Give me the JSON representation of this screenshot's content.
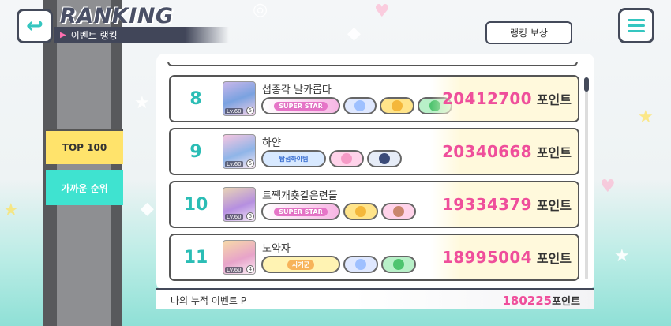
{
  "header": {
    "title": "RANKING",
    "subtitle": "이벤트 랭킹",
    "reward_button": "랭킹 보상"
  },
  "side_tabs": [
    {
      "label": "TOP 100"
    },
    {
      "label": "가까운 순위"
    }
  ],
  "rows": [
    {
      "rank": "8",
      "name": "섭종각 날카롭다",
      "points": "20412700",
      "unit": "포인트",
      "avatar_lv": "Lv.60",
      "star": "5",
      "badges": [
        "superstar",
        "blue",
        "small-gold",
        "small-green"
      ]
    },
    {
      "rank": "9",
      "name": "하얀",
      "points": "20340668",
      "unit": "포인트",
      "avatar_lv": "Lv.60",
      "star": "5",
      "badges": [
        "blue-text",
        "small-pink",
        "small-navy"
      ]
    },
    {
      "rank": "10",
      "name": "트짹개춋같은련들",
      "points": "19334379",
      "unit": "포인트",
      "avatar_lv": "Lv.60",
      "star": "5",
      "badges": [
        "superstar",
        "small-gold",
        "small-pink"
      ]
    },
    {
      "rank": "11",
      "name": "노약자",
      "points": "18995004",
      "unit": "포인트",
      "avatar_lv": "Lv.60",
      "star": "4",
      "badges": [
        "yellow",
        "blue",
        "small-green"
      ]
    }
  ],
  "badge_text": {
    "superstar": "SUPER STAR",
    "blue_text": "탑섬하이템",
    "yellow_text": "사기꾼"
  },
  "footer": {
    "label": "나의 누적 이벤트 P",
    "value": "180225",
    "unit": "포인트"
  },
  "colors": {
    "accent_teal": "#2bbdb5",
    "points_pink": "#ef4f9b",
    "frame_navy": "#444a5a",
    "tab_yellow": "#ffe36b",
    "tab_teal": "#3fe3d0"
  },
  "icons": {
    "back": "back-arrow-icon",
    "menu": "hamburger-menu-icon"
  }
}
